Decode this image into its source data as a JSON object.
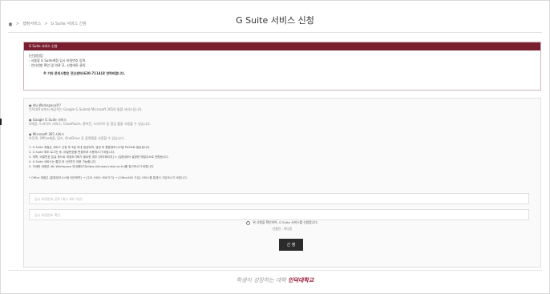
{
  "breadcrumb": {
    "items": [
      "행정서비스",
      ">",
      "G Suite 서비스 신청"
    ]
  },
  "page_title": "G Suite 서비스 신청",
  "guide_panel": {
    "header": "G Suite 서비스 신청",
    "method_title": "[신청방법]",
    "lines": [
      "- 사용할 G Suite계정 임시 비밀번호 입력.",
      "- 인터넷창 확인 및 약관 후, 신청버튼 클릭."
    ],
    "note": "※ 기타 문의사항은 전산센터(630-7114)로 연락바랍니다."
  },
  "info": {
    "ws_title": "Idu Workspace란?",
    "ws_desc": "인덕대학교에서 제공하는 Google G Suite와 Microsoft 365의 통합 서비스입니다.",
    "google_title": "Google G Suite 서비스",
    "google_desc": "G메일, 드라이브 서비스, ClassRoom, 행아웃, 드라이브 등 협업 툴을 사용할 수 있습니다.",
    "ms_title": "Microsoft 365 서비스",
    "ms_desc": "아웃룩, Office제품, 팀즈, OneDrive 등 플랫폼을 사용할 수 있습니다.",
    "steps": [
      "1. G Suite 계정은 서비스 신청 후 3일 이내 생성되며, 생성 후 활용정보시스템 PUSH로 발송됩니다.",
      "2. G Suite 최초 로그인 후, 비밀번호를 변경하여 사용하시기 바랍니다.",
      "3. 재학, 비밀번호 분실 등으로 계정초기화가 필요한 경우 [마이페이지] > [설정]에서 설정한 메일주소로 전환됩니다.",
      "4. G Suite 서비스는 졸업 후 1년까지 이용 가능합니다.",
      "5. 자세한 내용은 Idu Workspace 안내페이지(https://idusws.induk.ac.kr)를 참고하시기 바랍니다."
    ],
    "link_text": "https://idusws.induk.ac.kr",
    "office_note": "* Office 제품은 [통합정보시스템 메인화면] → [주요 서비스 바로가기] → [Office365 가입] 서비스를 통해서 가입하시기 바랍니다."
  },
  "form": {
    "password_placeholder": "임시 비밀번호 입력 (최소 8자 이상)",
    "confirm_placeholder": "임시 비밀번호 확인",
    "agree_label": "위 사항을 확인하여, G Suite 서비스를 신청합니다.",
    "applicant_line": "신청인 : 이다윤",
    "submit_label": "신 청"
  },
  "footer": {
    "slogan": "학생이 성장하는 대학",
    "brand": "인덕대학교"
  },
  "colors": {
    "accent": "#7a1f30",
    "button": "#2b2b2b",
    "brand": "#9b1b3c"
  }
}
